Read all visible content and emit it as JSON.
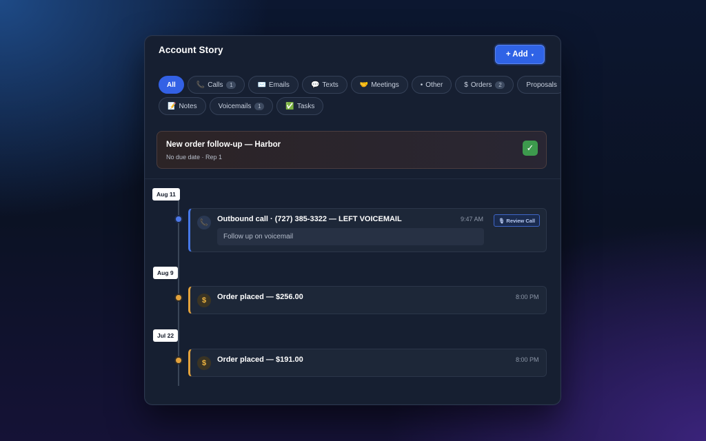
{
  "panel": {
    "title": "Account Story",
    "add_button": {
      "label": "+ Add",
      "caret": "▾"
    }
  },
  "filters": {
    "row1": [
      {
        "name": "all",
        "icon": "",
        "label": "All",
        "count": "",
        "active": true
      },
      {
        "name": "calls",
        "icon": "📞",
        "label": "Calls",
        "count": "1"
      },
      {
        "name": "emails",
        "icon": "✉️",
        "label": "Emails",
        "count": ""
      },
      {
        "name": "texts",
        "icon": "💬",
        "label": "Texts",
        "count": ""
      },
      {
        "name": "meetings",
        "icon": "🤝",
        "label": "Meetings",
        "count": ""
      },
      {
        "name": "other",
        "icon": "•",
        "label": "Other",
        "count": ""
      },
      {
        "name": "orders",
        "icon": "$",
        "label": "Orders",
        "count": "2"
      },
      {
        "name": "proposals",
        "icon": "",
        "label": "Proposals",
        "count": ""
      }
    ],
    "row2": [
      {
        "name": "notes",
        "icon": "📝",
        "label": "Notes",
        "count": ""
      },
      {
        "name": "voicemails",
        "icon": "",
        "label": "Voicemails",
        "count": "1"
      },
      {
        "name": "tasks",
        "icon": "✅",
        "label": "Tasks",
        "count": ""
      }
    ]
  },
  "task": {
    "title": "New order follow-up — Harbor",
    "subtitle": "No due date · Rep 1",
    "check_icon": "✓"
  },
  "timeline": [
    {
      "date": "Aug 11",
      "type": "call",
      "icon": "📞",
      "title": "Outbound call · (727) 385-3322 — LEFT VOICEMAIL",
      "time": "9:47 AM",
      "note": "Follow up on voicemail",
      "action": {
        "icon": "🎙",
        "label": "Review Call"
      }
    },
    {
      "date": "Aug 9",
      "type": "order",
      "icon": "$",
      "title": "Order placed — $256.00",
      "time": "8:00 PM"
    },
    {
      "date": "Jul 22",
      "type": "order",
      "icon": "$",
      "title": "Order placed — $191.00",
      "time": "8:00 PM"
    }
  ],
  "colors": {
    "accent": "#2f63e6",
    "call": "#4678e8",
    "order": "#e3a23c",
    "success": "#3d9a4d",
    "panel_bg": "#161f31"
  }
}
